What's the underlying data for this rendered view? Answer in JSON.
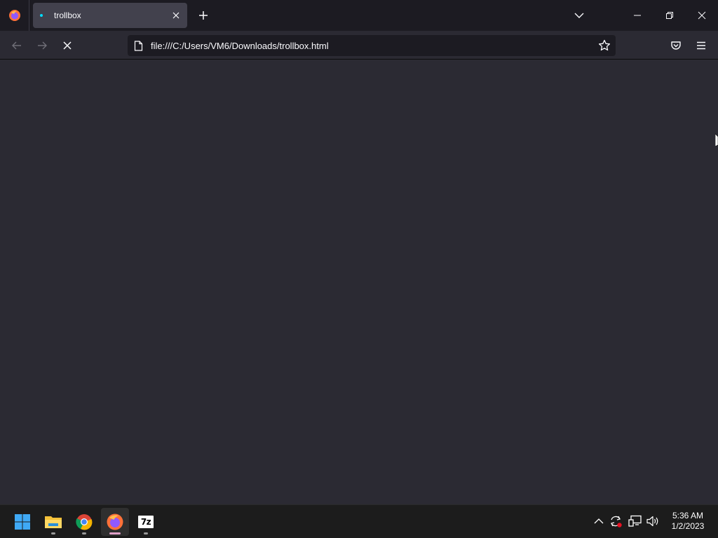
{
  "tab": {
    "title": "trollbox"
  },
  "urlbar": {
    "url": "file:///C:/Users/VM6/Downloads/trollbox.html"
  },
  "taskbar": {
    "apps": [
      "start-windows",
      "file-explorer",
      "chrome",
      "firefox",
      "7-zip"
    ],
    "zip_label": "7z"
  },
  "clock": {
    "time": "5:36 AM",
    "date": "1/2/2023"
  },
  "colors": {
    "tabbar_bg": "#1c1b22",
    "toolbar_bg": "#2b2a33",
    "urlbar_bg": "#1c1b22",
    "content_bg": "#2b2a33",
    "taskbar_bg": "#1c1c1c"
  }
}
